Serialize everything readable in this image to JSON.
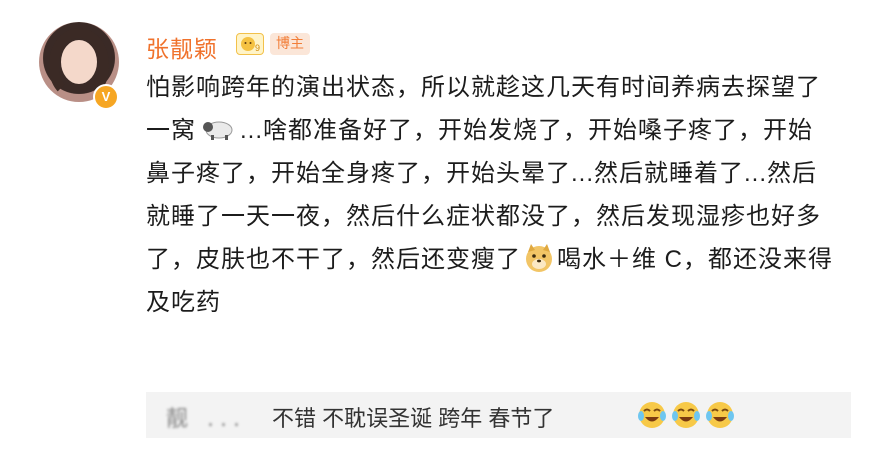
{
  "post": {
    "author": {
      "name": "张靓颖",
      "level_badge_icon": "fan-level-icon",
      "role_badge": "博主",
      "verified_icon": "verified-v-icon",
      "verified_letter": "V"
    },
    "text": {
      "part1": "怕影响跨年的演出状态，所以就趁这几天有时间养病去探望了一窝",
      "emoji1": "sheep-emoji",
      "part2": "...啥都准备好了，开始发烧了，开始嗓子疼了，开始鼻子疼了，开始全身疼了，开始头晕了...然后就睡着了...然后就睡了一天一夜，然后什么症状都没了，然后发现湿疹也好多了，皮肤也不干了，然后还变瘦了",
      "emoji2": "doge-emoji",
      "part3": "喝水＋维 C，都还没来得及吃药"
    }
  },
  "reply": {
    "handle": "靓 ...",
    "text": "不错 不耽误圣诞 跨年 春节了",
    "emojis": [
      "cry-laugh-emoji",
      "cry-laugh-emoji",
      "cry-laugh-emoji"
    ]
  },
  "colors": {
    "username": "#f0722c",
    "badge_bg": "#fbe6d8",
    "reply_bg": "#f3f3f3"
  }
}
